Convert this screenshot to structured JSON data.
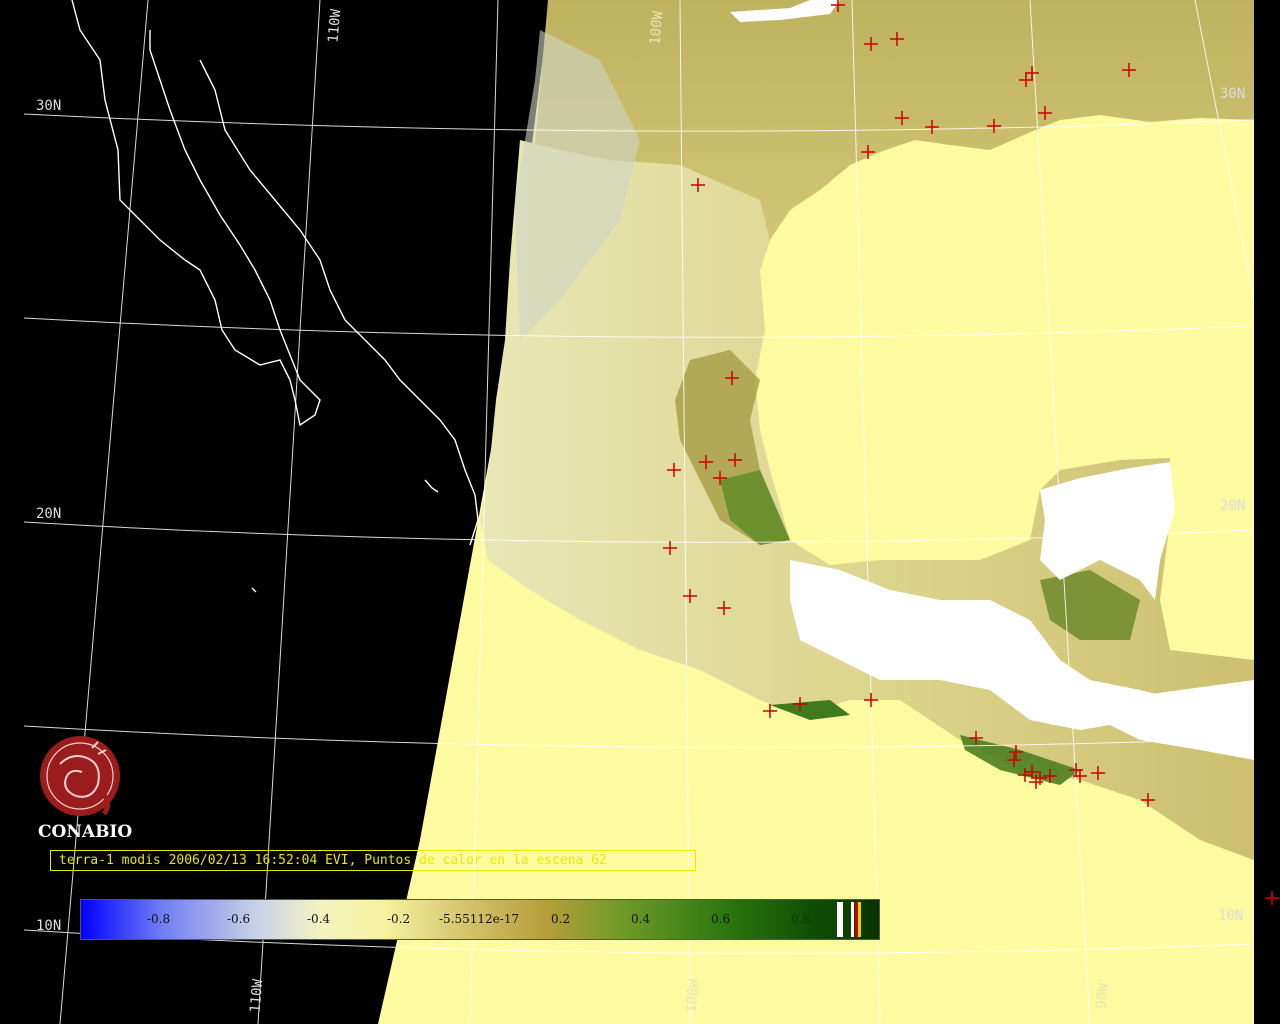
{
  "colors": {
    "background": "#000000",
    "ocean": "#fcfba0",
    "land_dry": "#f2ef9c",
    "land_mid": "#c7b965",
    "land_veg": "#3f7a1e",
    "cloud": "#ffffff",
    "coastline": "#ffffff",
    "grid": "#ffffff",
    "fire_marker": "#cc0000",
    "caption": "#e8e800",
    "logo": "#9b1c1c"
  },
  "logo": {
    "text": "CONABIO",
    "icon": "conabio-emblem-icon"
  },
  "caption": {
    "text": "terra-1 modis 2006/02/13 16:52:04 EVI, Puntos de calor en la escena 62"
  },
  "colorbar": {
    "labels": [
      "-0.8",
      "-0.6",
      "-0.4",
      "-0.2",
      "-5.55112e-17",
      "0.2",
      "0.4",
      "0.6",
      "0.8"
    ]
  },
  "grid_labels": {
    "lat_30_left": "30N",
    "lat_20_left": "20N",
    "lat_10_left": "10N",
    "lat_30_right": "30N",
    "lat_20_right": "20N",
    "lat_10_right": "10N",
    "lon_110_top": "110W",
    "lon_110_bottom": "110W",
    "lon_100_top": "100W",
    "lon_100_bottom": "100W",
    "lon_90_bottom": "90W"
  },
  "fire_marker_icon": "crosshair-icon"
}
